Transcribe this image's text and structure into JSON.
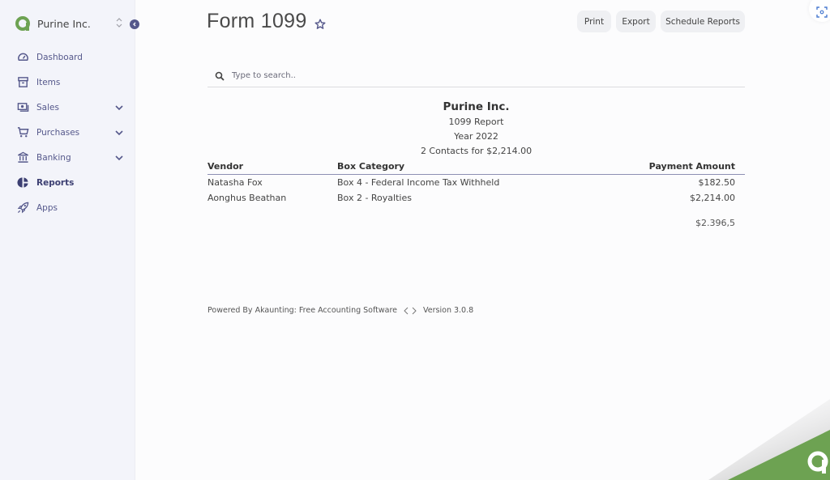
{
  "sidebar": {
    "company_name": "Purine Inc.",
    "items": [
      {
        "label": "Dashboard",
        "icon": "gauge-icon",
        "has_submenu": false,
        "active": false
      },
      {
        "label": "Items",
        "icon": "archive-box-icon",
        "has_submenu": false,
        "active": false
      },
      {
        "label": "Sales",
        "icon": "money-icon",
        "has_submenu": true,
        "active": false
      },
      {
        "label": "Purchases",
        "icon": "shopping-cart-icon",
        "has_submenu": true,
        "active": false
      },
      {
        "label": "Banking",
        "icon": "bank-icon",
        "has_submenu": true,
        "active": false
      },
      {
        "label": "Reports",
        "icon": "pie-chart-icon",
        "has_submenu": false,
        "active": true
      },
      {
        "label": "Apps",
        "icon": "rocket-icon",
        "has_submenu": false,
        "active": false
      }
    ]
  },
  "header": {
    "title": "Form 1099",
    "buttons": {
      "print": "Print",
      "export": "Export",
      "schedule": "Schedule Reports"
    }
  },
  "search": {
    "placeholder": "Type to search.."
  },
  "report": {
    "company": "Purine Inc.",
    "subtitle": "1099 Report",
    "year": "Year 2022",
    "summary": "2 Contacts for $2,214.00",
    "columns": [
      "Vendor",
      "Box Category",
      "Payment Amount"
    ],
    "rows": [
      {
        "vendor": "Natasha Fox",
        "category": "Box 4 - Federal Income Tax Withheld",
        "amount": "$182.50"
      },
      {
        "vendor": "Aonghus Beathan",
        "category": "Box 2 - Royalties",
        "amount": "$2,214.00"
      }
    ],
    "total": "$2.396,5"
  },
  "footer": {
    "powered_by": "Powered By Akaunting: Free Accounting Software",
    "version": "Version 3.0.8"
  },
  "colors": {
    "brand_green": "#6da252",
    "accent_purple": "#55588b",
    "sidebar_bg": "#f3f4fa"
  }
}
